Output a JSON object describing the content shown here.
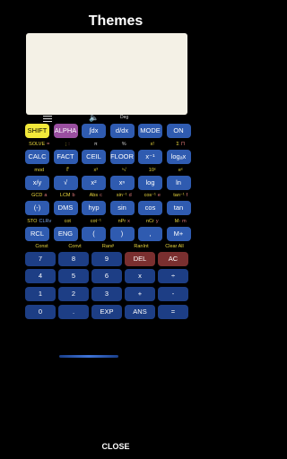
{
  "header": {
    "title": "Themes"
  },
  "status": {
    "deg": "Deg"
  },
  "rows": [
    {
      "buttons": [
        {
          "label": "SHIFT",
          "style": "yellow",
          "name": "shift-button"
        },
        {
          "label": "ALPHA",
          "style": "purple",
          "name": "alpha-button"
        },
        {
          "label": "∫dx",
          "style": "blue",
          "name": "integral-button"
        },
        {
          "label": "d/dx",
          "style": "blue",
          "name": "derivative-button"
        },
        {
          "label": "MODE",
          "style": "blue",
          "name": "mode-button"
        },
        {
          "label": "ON",
          "style": "blue",
          "name": "on-button"
        }
      ]
    },
    {
      "sub": [
        {
          "texts": [
            {
              "t": "SOLVE",
              "c": "s-yel"
            },
            {
              "t": "=",
              "c": "s-red"
            }
          ]
        },
        {
          "texts": [
            {
              "t": ";",
              "c": "s-yel"
            },
            {
              "t": ":",
              "c": "s-red"
            }
          ]
        },
        {
          "texts": [
            {
              "t": "π",
              "c": "s-grey"
            }
          ]
        },
        {
          "texts": [
            {
              "t": "%",
              "c": "s-grey"
            }
          ]
        },
        {
          "texts": [
            {
              "t": "x!",
              "c": "s-yel"
            }
          ]
        },
        {
          "texts": [
            {
              "t": "Σ",
              "c": "s-yel"
            },
            {
              "t": "Π",
              "c": "s-red"
            }
          ]
        }
      ]
    },
    {
      "buttons": [
        {
          "label": "CALC",
          "style": "blue",
          "name": "calc-button"
        },
        {
          "label": "FACT",
          "style": "blue",
          "name": "fact-button"
        },
        {
          "label": "CEIL",
          "style": "blue",
          "name": "ceil-button"
        },
        {
          "label": "FLOOR",
          "style": "blue",
          "name": "floor-button"
        },
        {
          "label": "x⁻¹",
          "style": "blue",
          "name": "reciprocal-button"
        },
        {
          "label": "logₐx",
          "style": "blue",
          "name": "logax-button"
        }
      ]
    },
    {
      "sub": [
        {
          "texts": [
            {
              "t": "mod",
              "c": "s-yel"
            }
          ]
        },
        {
          "texts": [
            {
              "t": "∜",
              "c": "s-yel"
            }
          ]
        },
        {
          "texts": [
            {
              "t": "x³",
              "c": "s-yel"
            }
          ]
        },
        {
          "texts": [
            {
              "t": "ⁿ√",
              "c": "s-yel"
            }
          ]
        },
        {
          "texts": [
            {
              "t": "10ˣ",
              "c": "s-yel"
            }
          ]
        },
        {
          "texts": [
            {
              "t": "eˣ",
              "c": "s-yel"
            }
          ]
        }
      ]
    },
    {
      "buttons": [
        {
          "label": "x/y",
          "style": "blue",
          "name": "fraction-button"
        },
        {
          "label": "√",
          "style": "blue",
          "name": "sqrt-button"
        },
        {
          "label": "x²",
          "style": "blue",
          "name": "square-button"
        },
        {
          "label": "xⁿ",
          "style": "blue",
          "name": "power-button"
        },
        {
          "label": "log",
          "style": "blue",
          "name": "log-button"
        },
        {
          "label": "ln",
          "style": "blue",
          "name": "ln-button"
        }
      ]
    },
    {
      "sub": [
        {
          "texts": [
            {
              "t": "GCD",
              "c": "s-yel"
            },
            {
              "t": "a",
              "c": "s-red"
            }
          ]
        },
        {
          "texts": [
            {
              "t": "LCM",
              "c": "s-yel"
            },
            {
              "t": "b",
              "c": "s-red"
            }
          ]
        },
        {
          "texts": [
            {
              "t": "Abs",
              "c": "s-yel"
            },
            {
              "t": "c",
              "c": "s-red"
            }
          ]
        },
        {
          "texts": [
            {
              "t": "sin⁻¹",
              "c": "s-yel"
            },
            {
              "t": "d",
              "c": "s-red"
            }
          ]
        },
        {
          "texts": [
            {
              "t": "cos⁻¹",
              "c": "s-yel"
            },
            {
              "t": "e",
              "c": "s-red"
            }
          ]
        },
        {
          "texts": [
            {
              "t": "tan⁻¹",
              "c": "s-yel"
            },
            {
              "t": "f",
              "c": "s-red"
            }
          ]
        }
      ]
    },
    {
      "buttons": [
        {
          "label": "(-)",
          "style": "blue",
          "name": "negate-button"
        },
        {
          "label": "DMS",
          "style": "blue",
          "name": "dms-button"
        },
        {
          "label": "hyp",
          "style": "blue",
          "name": "hyp-button"
        },
        {
          "label": "sin",
          "style": "blue",
          "name": "sin-button"
        },
        {
          "label": "cos",
          "style": "blue",
          "name": "cos-button"
        },
        {
          "label": "tan",
          "style": "blue",
          "name": "tan-button"
        }
      ]
    },
    {
      "sub": [
        {
          "texts": [
            {
              "t": "STO",
              "c": "s-yel"
            },
            {
              "t": "CLRv",
              "c": "s-blue"
            }
          ]
        },
        {
          "texts": [
            {
              "t": "cot",
              "c": "s-yel"
            }
          ]
        },
        {
          "texts": [
            {
              "t": "cot⁻¹",
              "c": "s-yel"
            }
          ]
        },
        {
          "texts": [
            {
              "t": "nPr",
              "c": "s-yel"
            },
            {
              "t": "x",
              "c": "s-red"
            }
          ]
        },
        {
          "texts": [
            {
              "t": "nCr",
              "c": "s-yel"
            },
            {
              "t": "y",
              "c": "s-red"
            }
          ]
        },
        {
          "texts": [
            {
              "t": "M-",
              "c": "s-yel"
            },
            {
              "t": "m",
              "c": "s-red"
            }
          ]
        }
      ]
    },
    {
      "buttons": [
        {
          "label": "RCL",
          "style": "blue",
          "name": "rcl-button"
        },
        {
          "label": "ENG",
          "style": "blue",
          "name": "eng-button"
        },
        {
          "label": "(",
          "style": "blue",
          "name": "open-paren-button"
        },
        {
          "label": ")",
          "style": "blue",
          "name": "close-paren-button"
        },
        {
          "label": ",",
          "style": "blue",
          "name": "comma-button"
        },
        {
          "label": "M+",
          "style": "blue",
          "name": "memory-plus-button"
        }
      ]
    },
    {
      "sub5": [
        {
          "texts": [
            {
              "t": "Const",
              "c": "s-yel"
            }
          ]
        },
        {
          "texts": [
            {
              "t": "Convt",
              "c": "s-yel"
            }
          ]
        },
        {
          "texts": [
            {
              "t": "Ran#",
              "c": "s-yel"
            }
          ]
        },
        {
          "texts": [
            {
              "t": "RanInt",
              "c": "s-yel"
            }
          ]
        },
        {
          "texts": [
            {
              "t": "Clear All",
              "c": "s-yel"
            }
          ]
        }
      ]
    },
    {
      "buttons5": [
        {
          "label": "7",
          "style": "navy",
          "name": "digit-7-button"
        },
        {
          "label": "8",
          "style": "navy",
          "name": "digit-8-button"
        },
        {
          "label": "9",
          "style": "navy",
          "name": "digit-9-button"
        },
        {
          "label": "DEL",
          "style": "red",
          "name": "delete-button"
        },
        {
          "label": "AC",
          "style": "red",
          "name": "all-clear-button"
        }
      ]
    },
    {
      "buttons5": [
        {
          "label": "4",
          "style": "navy",
          "name": "digit-4-button"
        },
        {
          "label": "5",
          "style": "navy",
          "name": "digit-5-button"
        },
        {
          "label": "6",
          "style": "navy",
          "name": "digit-6-button"
        },
        {
          "label": "x",
          "style": "navy",
          "name": "multiply-button"
        },
        {
          "label": "÷",
          "style": "navy",
          "name": "divide-button"
        }
      ]
    },
    {
      "buttons5": [
        {
          "label": "1",
          "style": "navy",
          "name": "digit-1-button"
        },
        {
          "label": "2",
          "style": "navy",
          "name": "digit-2-button"
        },
        {
          "label": "3",
          "style": "navy",
          "name": "digit-3-button"
        },
        {
          "label": "+",
          "style": "navy",
          "name": "add-button"
        },
        {
          "label": "-",
          "style": "navy",
          "name": "subtract-button"
        }
      ]
    },
    {
      "buttons5": [
        {
          "label": "0",
          "style": "navy",
          "name": "digit-0-button"
        },
        {
          "label": ".",
          "style": "navy",
          "name": "decimal-button"
        },
        {
          "label": "EXP",
          "style": "navy",
          "name": "exp-button"
        },
        {
          "label": "ANS",
          "style": "navy",
          "name": "ans-button"
        },
        {
          "label": "=",
          "style": "navy",
          "name": "equals-button"
        }
      ]
    }
  ],
  "footer": {
    "close_label": "CLOSE"
  }
}
